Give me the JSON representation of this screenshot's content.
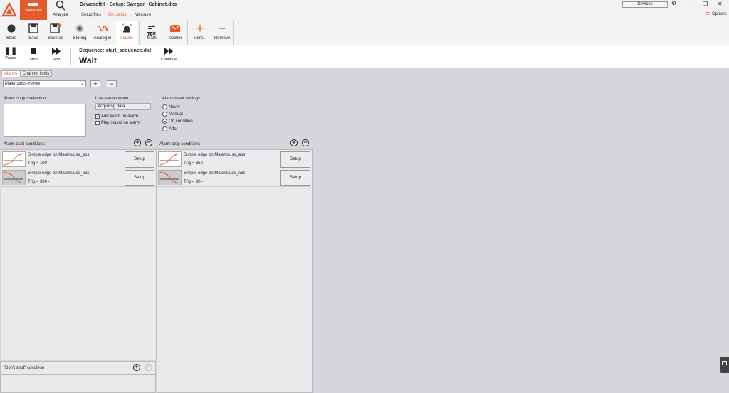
{
  "app": {
    "title": "DewesoftX - Setup: Swegon_Cabinet.dxs",
    "measure_label": "Measure",
    "analyze_label": "Analyze",
    "devices_label": "Devices",
    "options_label": "Options"
  },
  "tabs": [
    "Setup files",
    "Ch. setup",
    "Measure"
  ],
  "ribbon": {
    "items": [
      "Store",
      "Save",
      "Save as",
      "Storing",
      "Analog in",
      "Alarms",
      "Math",
      "Notifier",
      "More...",
      "Remove"
    ]
  },
  "sequence": {
    "title": "Sequence: start_sequence.dxt",
    "state": "Wait",
    "buttons": [
      "Pause",
      "Stop",
      "Skip"
    ],
    "continue_label": "Continue"
  },
  "subtabs": [
    "Alarms",
    "Channel limits"
  ],
  "alarm_select": {
    "value": "Malerisluss-Yellow"
  },
  "labels": {
    "output_selection": "Alarm output selection",
    "use_when": "Use alarms when",
    "reset_settings": "Alarm reset settings",
    "start_conditions": "Alarm start conditions",
    "stop_conditions": "Alarm stop conditions",
    "dont_start": "\"Don't start\" condition"
  },
  "use_when": {
    "value": "Acquiring data",
    "add_event": "Add event on alarm",
    "play_sound": "Play sound on alarm"
  },
  "reset": {
    "options": [
      "Never",
      "Manual",
      "On condition",
      "After"
    ],
    "selected": "On condition"
  },
  "start_conditions": [
    {
      "name": "Simple edge on Malerisluss_abs",
      "trig": "Trig = 100 -",
      "setup": "Setup"
    },
    {
      "name": "Simple edge on Malerisluss_abs",
      "trig": "Trig = 330 -",
      "setup": "Setup"
    }
  ],
  "stop_conditions": [
    {
      "name": "Simple edge on Malerisluss_abs",
      "trig": "Trig = 350 -",
      "setup": "Setup"
    },
    {
      "name": "Simple edge on Malerisluss_abs",
      "trig": "Trig = 90 -",
      "setup": "Setup"
    }
  ],
  "colors": {
    "accent": "#e55a2b"
  }
}
